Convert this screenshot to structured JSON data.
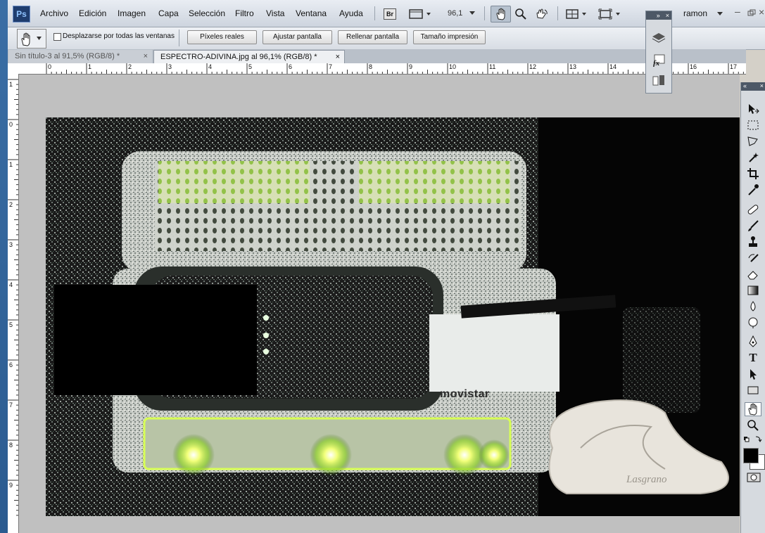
{
  "app": {
    "logo": "Ps",
    "menu": [
      "Archivo",
      "Edición",
      "Imagen",
      "Capa",
      "Selección",
      "Filtro",
      "Vista",
      "Ventana",
      "Ayuda"
    ],
    "bridge_label": "Br",
    "zoom_value": "96,1",
    "user": "ramon"
  },
  "options": {
    "checkbox_label": "Desplazarse por todas las ventanas",
    "buttons": [
      "Píxeles reales",
      "Ajustar pantalla",
      "Rellenar pantalla",
      "Tamaño impresión"
    ]
  },
  "tabs": [
    {
      "label": "Sin título-3 al 91,5% (RGB/8) *",
      "close": "×"
    },
    {
      "label": "ESPECTRO-ADIVINA.jpg al 96,1% (RGB/8) *",
      "close": "×"
    }
  ],
  "ruler": {
    "h_labels": [
      "0",
      "1",
      "2",
      "3",
      "4",
      "5",
      "6",
      "7",
      "8",
      "9",
      "10",
      "11",
      "12",
      "13",
      "14",
      "15",
      "16",
      "17"
    ],
    "v_labels": [
      "1",
      "0",
      "1",
      "2",
      "3",
      "4",
      "5",
      "6",
      "7",
      "8",
      "9"
    ]
  },
  "photo": {
    "brand_text": "movistar",
    "stamp_text": "Lasgrano"
  },
  "icons": {
    "hand": "hand-icon",
    "zoom": "zoom-icon",
    "rotate": "rotate-view-icon"
  },
  "colors": {
    "menu_bg": "#dfe4ea",
    "pasteboard": "#c0c0c0",
    "led_green": "#c8ff3c"
  }
}
